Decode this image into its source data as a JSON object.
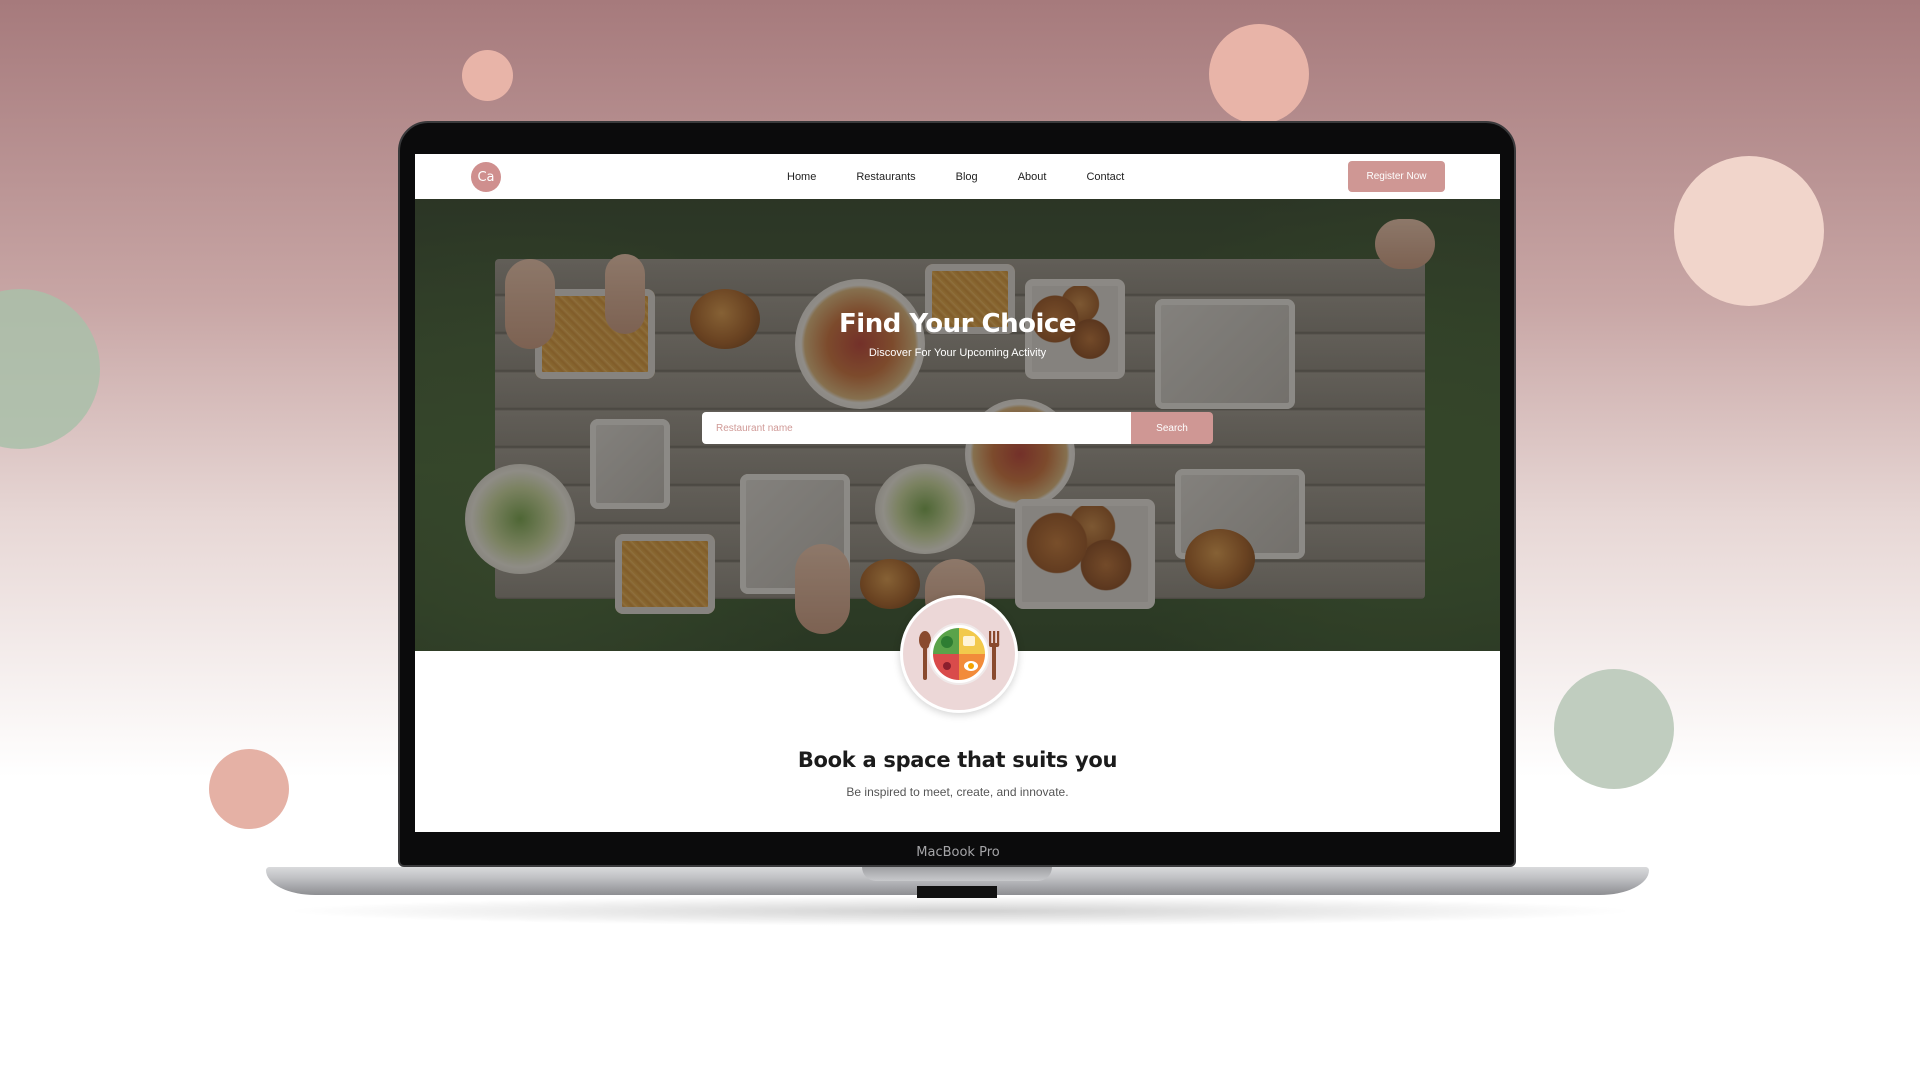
{
  "navbar": {
    "logo_text": "Ca",
    "links": [
      "Home",
      "Restaurants",
      "Blog",
      "About",
      "Contact"
    ],
    "register_label": "Register Now"
  },
  "hero": {
    "title": "Find Your Choice",
    "subtitle": "Discover For Your Upcoming Activity",
    "search": {
      "placeholder": "Restaurant name",
      "button_label": "Search"
    }
  },
  "section": {
    "title": "Book a space that suits you",
    "subtitle": "Be inspired to meet, create, and innovate."
  },
  "device": {
    "label": "MacBook Pro"
  },
  "colors": {
    "accent": "#cf9794",
    "logo": "#cf8f8e",
    "plate_bg": "#ecd7d7"
  },
  "icons": {
    "logo": "brand-logo-icon",
    "plate": "plate-cutlery-icon"
  }
}
